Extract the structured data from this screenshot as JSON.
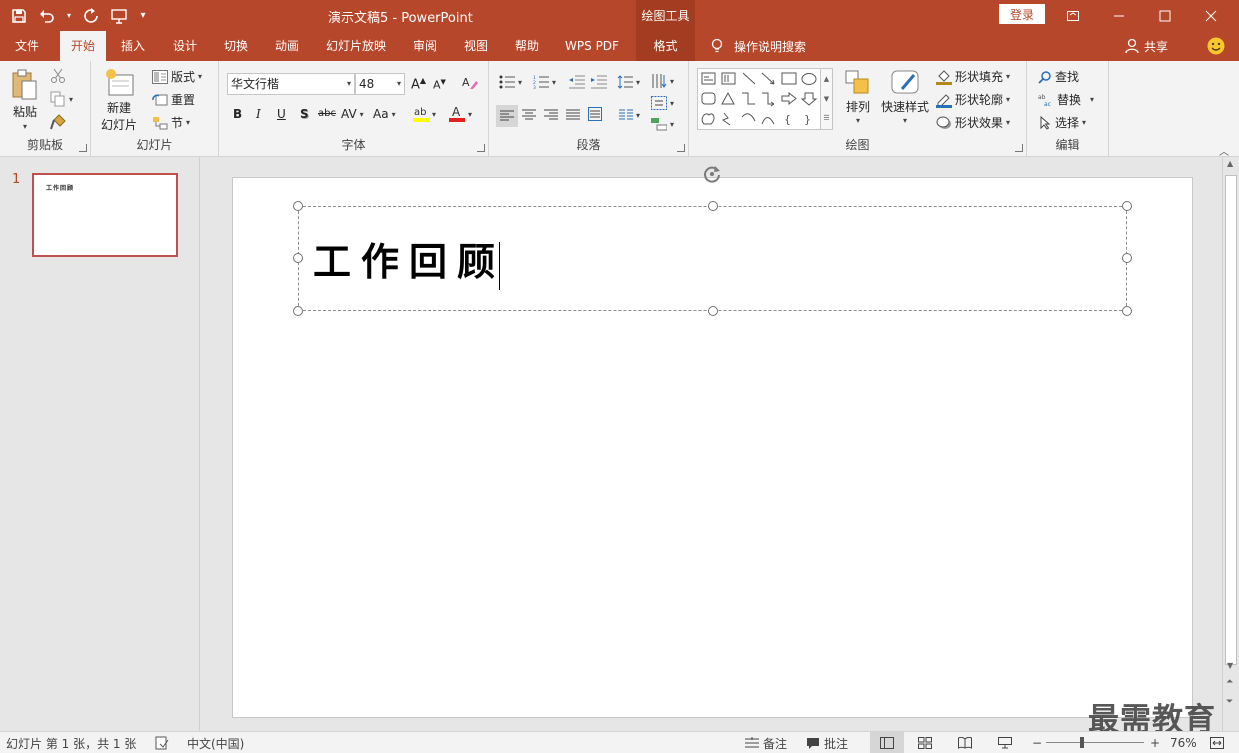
{
  "window": {
    "title": "演示文稿5  -  PowerPoint",
    "context_tab_header": "绘图工具",
    "login_label": "登录"
  },
  "tabs": [
    {
      "label": "文件"
    },
    {
      "label": "开始"
    },
    {
      "label": "插入"
    },
    {
      "label": "设计"
    },
    {
      "label": "切换"
    },
    {
      "label": "动画"
    },
    {
      "label": "幻灯片放映"
    },
    {
      "label": "审阅"
    },
    {
      "label": "视图"
    },
    {
      "label": "帮助"
    },
    {
      "label": "WPS PDF"
    },
    {
      "label": "格式"
    }
  ],
  "active_tab": "开始",
  "tell_me": "操作说明搜索",
  "share_label": "共享",
  "ribbon": {
    "clipboard": {
      "paste": "粘贴",
      "label": "剪贴板"
    },
    "slides": {
      "new_slide_line1": "新建",
      "new_slide_line2": "幻灯片",
      "layout": "版式",
      "reset": "重置",
      "section": "节",
      "label": "幻灯片"
    },
    "font": {
      "font_name": "华文行楷",
      "font_size": "48",
      "bold": "B",
      "italic": "I",
      "underline": "U",
      "shadow": "S",
      "strike": "abc",
      "spacing": "AV",
      "case": "Aa",
      "label": "字体"
    },
    "paragraph": {
      "label": "段落"
    },
    "drawing": {
      "arrange": "排列",
      "quick_styles": "快速样式",
      "shape_fill": "形状填充",
      "shape_outline": "形状轮廓",
      "shape_effects": "形状效果",
      "label": "绘图"
    },
    "editing": {
      "find": "查找",
      "replace": "替换",
      "select": "选择",
      "label": "编辑"
    }
  },
  "thumbnails": [
    {
      "number": "1",
      "title": "工作回顾"
    }
  ],
  "slide": {
    "title_text": "工作回顾"
  },
  "status": {
    "slide_info": "幻灯片 第 1 张，共 1 张",
    "language": "中文(中国)",
    "notes": "备注",
    "comments": "批注",
    "zoom": "76%",
    "zoom_minus": "−",
    "zoom_plus": "+"
  },
  "watermark": "最需教育",
  "colors": {
    "accent": "#b7472a",
    "accent_dark": "#a33c20",
    "ribbon_bg": "#f3f3f3",
    "workspace_bg": "#e6e6e6"
  }
}
